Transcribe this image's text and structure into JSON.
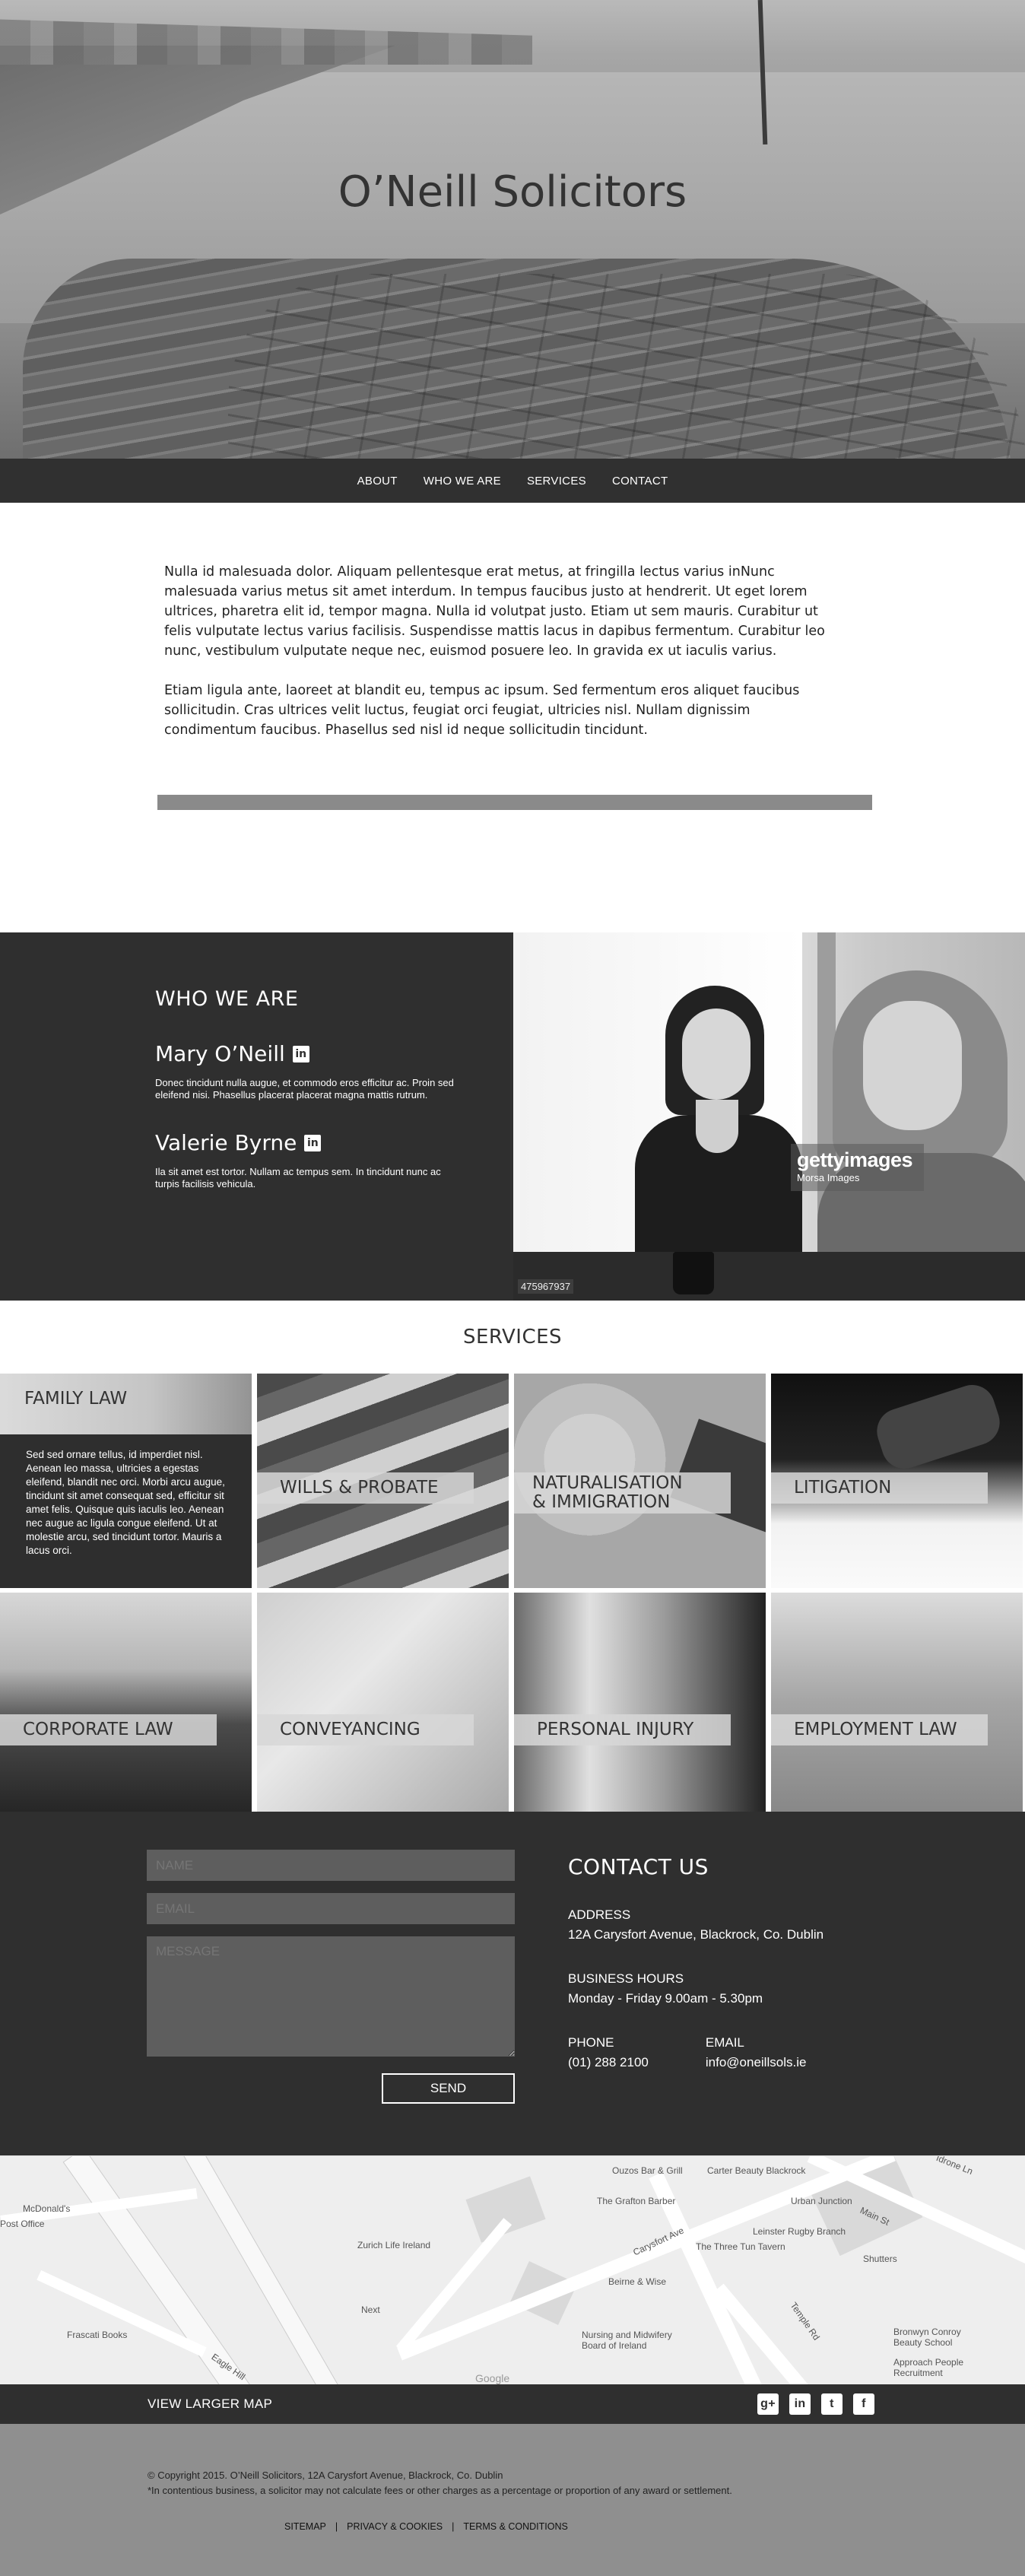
{
  "hero": {
    "title": "O’Neill Solicitors"
  },
  "nav": {
    "items": [
      "ABOUT",
      "WHO WE ARE",
      "SERVICES",
      "CONTACT"
    ]
  },
  "intro": {
    "p1": "Nulla id malesuada dolor. Aliquam pellentesque erat metus, at fringilla lectus varius inNunc malesuada varius metus sit amet interdum. In tempus faucibus justo at hendrerit. Ut eget lorem ultrices, pharetra elit id, tempor magna. Nulla id volutpat justo. Etiam ut sem mauris. Curabitur ut felis vulputate lectus varius facilisis. Suspendisse mattis lacus in dapibus fermentum. Curabitur leo nunc, vestibulum vulputate neque nec, euismod posuere leo. In gravida ex ut iaculis varius.",
    "p2": "Etiam ligula ante, laoreet at blandit eu, tempus ac ipsum. Sed fermentum eros aliquet faucibus sollicitudin. Cras ultrices velit luctus, feugiat orci feugiat, ultricies nisl. Nullam dignissim condimentum faucibus. Phasellus sed nisl id neque sollicitudin tincidunt."
  },
  "who": {
    "title": "WHO WE ARE",
    "people": [
      {
        "name": "Mary O’Neill",
        "bio": "Donec tincidunt nulla augue, et commodo eros efficitur ac. Proin sed eleifend nisi. Phasellus placerat placerat magna mattis rutrum."
      },
      {
        "name": "Valerie Byrne",
        "bio": "Ila sit amet est tortor. Nullam ac tempus sem. In tincidunt nunc ac turpis facilisis vehicula."
      }
    ],
    "linkedin_icon": "linkedin-icon",
    "photo": {
      "watermark": "gettyimages",
      "credit": "Morsa Images",
      "image_id": "475967937"
    }
  },
  "services": {
    "title": "SERVICES",
    "family": {
      "label": "FAMILY LAW",
      "desc": "Sed sed ornare tellus, id imperdiet nisl. Aenean leo massa, ultricies a egestas eleifend, blandit nec orci. Morbi arcu augue, tincidunt sit amet consequat sed, efficitur sit amet felis. Quisque quis iaculis leo. Aenean nec augue ac ligula congue eleifend. Ut at molestie arcu, sed tincidunt tortor. Mauris a lacus orci."
    },
    "tiles": [
      "WILLS & PROBATE",
      "NATURALISATION & IMMIGRATION",
      "LITIGATION",
      "CORPORATE LAW",
      "CONVEYANCING",
      "PERSONAL INJURY",
      "EMPLOYMENT LAW"
    ],
    "tile3_line1": "NATURALISATION",
    "tile3_line2": "& IMMIGRATION"
  },
  "contact": {
    "fields": {
      "name": "NAME",
      "email": "EMAIL",
      "message": "MESSAGE"
    },
    "send": "SEND",
    "title": "CONTACT US",
    "address_label": "ADDRESS",
    "address": "12A Carysfort Avenue, Blackrock, Co. Dublin",
    "hours_label": "BUSINESS HOURS",
    "hours": "Monday - Friday 9.00am - 5.30pm",
    "phone_label": "PHONE",
    "phone": "(01) 288 2100",
    "email_label": "EMAIL",
    "email": "info@oneillsols.ie"
  },
  "map": {
    "pois": [
      "Ouzos Bar & Grill",
      "Carter Beauty Blackrock",
      "The Grafton Barber",
      "Urban Junction",
      "Main St",
      "McDonald's",
      "Zurich Life Ireland",
      "Carysfort Ave",
      "Leinster Rugby Branch",
      "The Three Tun Tavern",
      "Shutters",
      "Beirne & Wise",
      "Frascati Books",
      "Nursing and Midwifery Board of Ireland",
      "Temple Rd",
      "Bronwyn Conroy Beauty School",
      "Approach People Recruitment",
      "Eagle Hill",
      "Next",
      "Google",
      "Post Office",
      "Idrone Ln"
    ]
  },
  "footer": {
    "map_link": "VIEW LARGER MAP",
    "social": [
      "google-plus-icon",
      "linkedin-icon",
      "twitter-icon",
      "facebook-icon"
    ],
    "copyright": "© Copyright 2015. O’Neill Solicitors, 12A Carysfort Avenue, Blackrock, Co. Dublin",
    "disclaimer": "*In contentious business, a solicitor may not calculate fees or other charges as a percentage or proportion of any award or settlement.",
    "links": [
      "SITEMAP",
      "|",
      "PRIVACY & COOKIES",
      "|",
      "TERMS & CONDITIONS"
    ]
  }
}
